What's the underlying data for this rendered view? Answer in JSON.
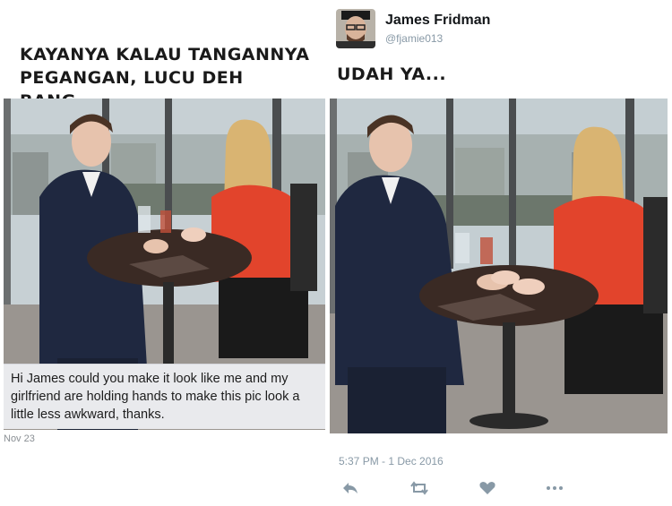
{
  "left_panel": {
    "caption": "KAYANYA KALAU TANGANNYA PEGANGAN, LUCU DEH BANG...",
    "message": "Hi James could you make it look like me and my girlfriend are holding hands to make this pic look a little less awkward, thanks.",
    "message_date": "Nov 23",
    "photo_icon": "restaurant-couple-photo"
  },
  "right_panel": {
    "author": {
      "display_name": "James Fridman",
      "handle": "@fjamie013",
      "avatar_icon": "avatar-icon"
    },
    "caption": "UDAH YA...",
    "photo_icon": "edited-couple-photo",
    "timestamp": "5:37 PM - 1 Dec 2016",
    "actions": [
      "reply-icon",
      "retweet-icon",
      "like-icon",
      "more-icon"
    ]
  },
  "colors": {
    "text_dark": "#1a1a1a",
    "muted": "#8899a6",
    "bubble": "#e9eaed",
    "jacket": "#1f2840",
    "blouse": "#e2442c",
    "table": "#3a2a24"
  }
}
